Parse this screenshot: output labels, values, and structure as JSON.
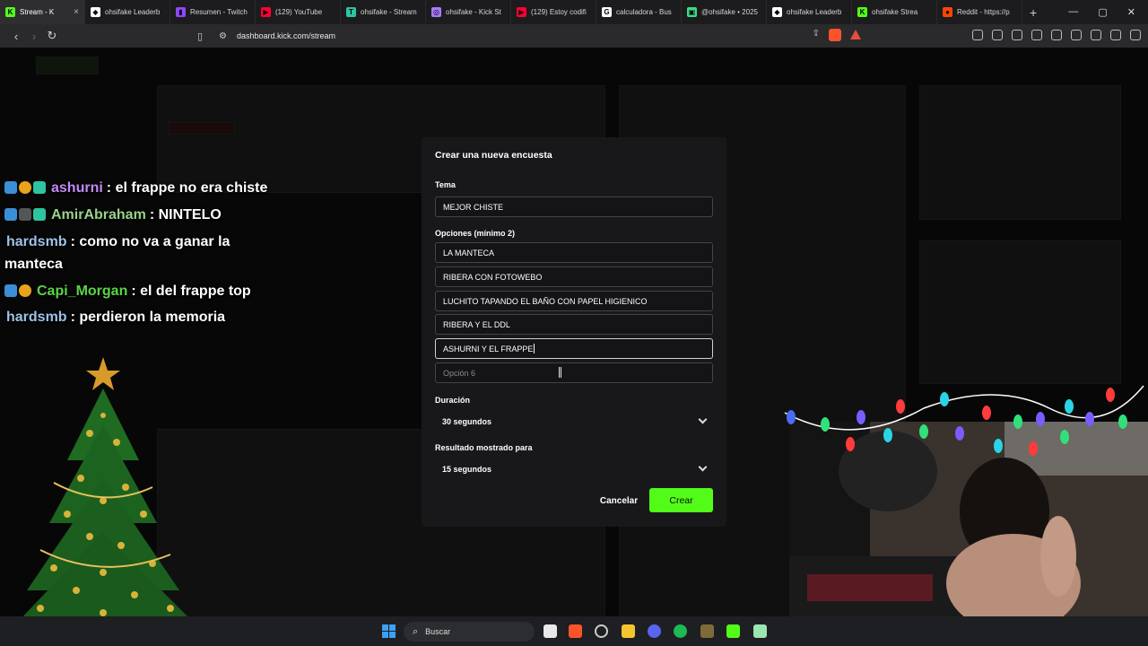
{
  "browser": {
    "tabs": [
      {
        "label": "Stream - K",
        "color": "#53fc18",
        "glyph": "K",
        "active": true
      },
      {
        "label": "ohsifake Leaderb",
        "color": "#ffffff",
        "glyph": "◆",
        "active": false
      },
      {
        "label": "Resumen - Twitch",
        "color": "#9146ff",
        "glyph": "▮",
        "active": false
      },
      {
        "label": "(129) YouTube",
        "color": "#ff0033",
        "glyph": "▶",
        "active": false
      },
      {
        "label": "ohsifake - Stream",
        "color": "#2ec4a0",
        "glyph": "T",
        "active": false
      },
      {
        "label": "ohsifake - Kick St",
        "color": "#a77bff",
        "glyph": "◎",
        "active": false
      },
      {
        "label": "(129) Estoy codifi",
        "color": "#ff0033",
        "glyph": "▶",
        "active": false
      },
      {
        "label": "calculadora - Bus",
        "color": "#ffffff",
        "glyph": "G",
        "active": false
      },
      {
        "label": "@ohsifake • 2025",
        "color": "#3ddc84",
        "glyph": "▣",
        "active": false
      },
      {
        "label": "ohsifake Leaderb",
        "color": "#ffffff",
        "glyph": "◆",
        "active": false
      },
      {
        "label": "ohsifake Strea",
        "color": "#53fc18",
        "glyph": "K",
        "active": false
      },
      {
        "label": "Reddit - https://p",
        "color": "#ff4500",
        "glyph": "●",
        "active": false
      }
    ],
    "new_tab": "+",
    "url": "dashboard.kick.com/stream"
  },
  "chat": [
    {
      "badges": [
        "b1",
        "b2",
        "b3"
      ],
      "user": "ashurni",
      "user_class": "u-ash",
      "text": ": el frappe no era chiste"
    },
    {
      "badges": [
        "b1",
        "b4",
        "b3"
      ],
      "user": "AmirAbraham",
      "user_class": "u-amir",
      "text": ": NINTELO"
    },
    {
      "badges": [],
      "user": "hardsmb",
      "user_class": "u-hards",
      "text": ": como no va a ganar la"
    },
    {
      "badges": [],
      "user": "",
      "user_class": "",
      "text": "manteca"
    },
    {
      "badges": [
        "b1",
        "b2"
      ],
      "user": "Capi_Morgan",
      "user_class": "u-capi",
      "text": ": el del frappe top"
    },
    {
      "badges": [],
      "user": "hardsmb",
      "user_class": "u-hards",
      "text": ": perdieron la memoria"
    }
  ],
  "poll": {
    "title": "Crear una nueva encuesta",
    "topic_label": "Tema",
    "topic_value": "MEJOR CHISTE",
    "options_label": "Opciones (mínimo 2)",
    "options": [
      "LA MANTECA",
      "RIBERA CON FOTOWEBO",
      "LUCHITO TAPANDO EL BAÑO CON PAPEL HIGIENICO",
      "RIBERA Y EL DDL",
      "ASHURNI Y EL FRAPPE"
    ],
    "option_placeholder": "Opción 6",
    "duration_label": "Duración",
    "duration_value": "30 segundos",
    "result_label": "Resultado mostrado para",
    "result_value": "15 segundos",
    "cancel_label": "Cancelar",
    "create_label": "Crear",
    "accent": "#53fc18"
  },
  "taskbar": {
    "search_label": "Buscar"
  }
}
